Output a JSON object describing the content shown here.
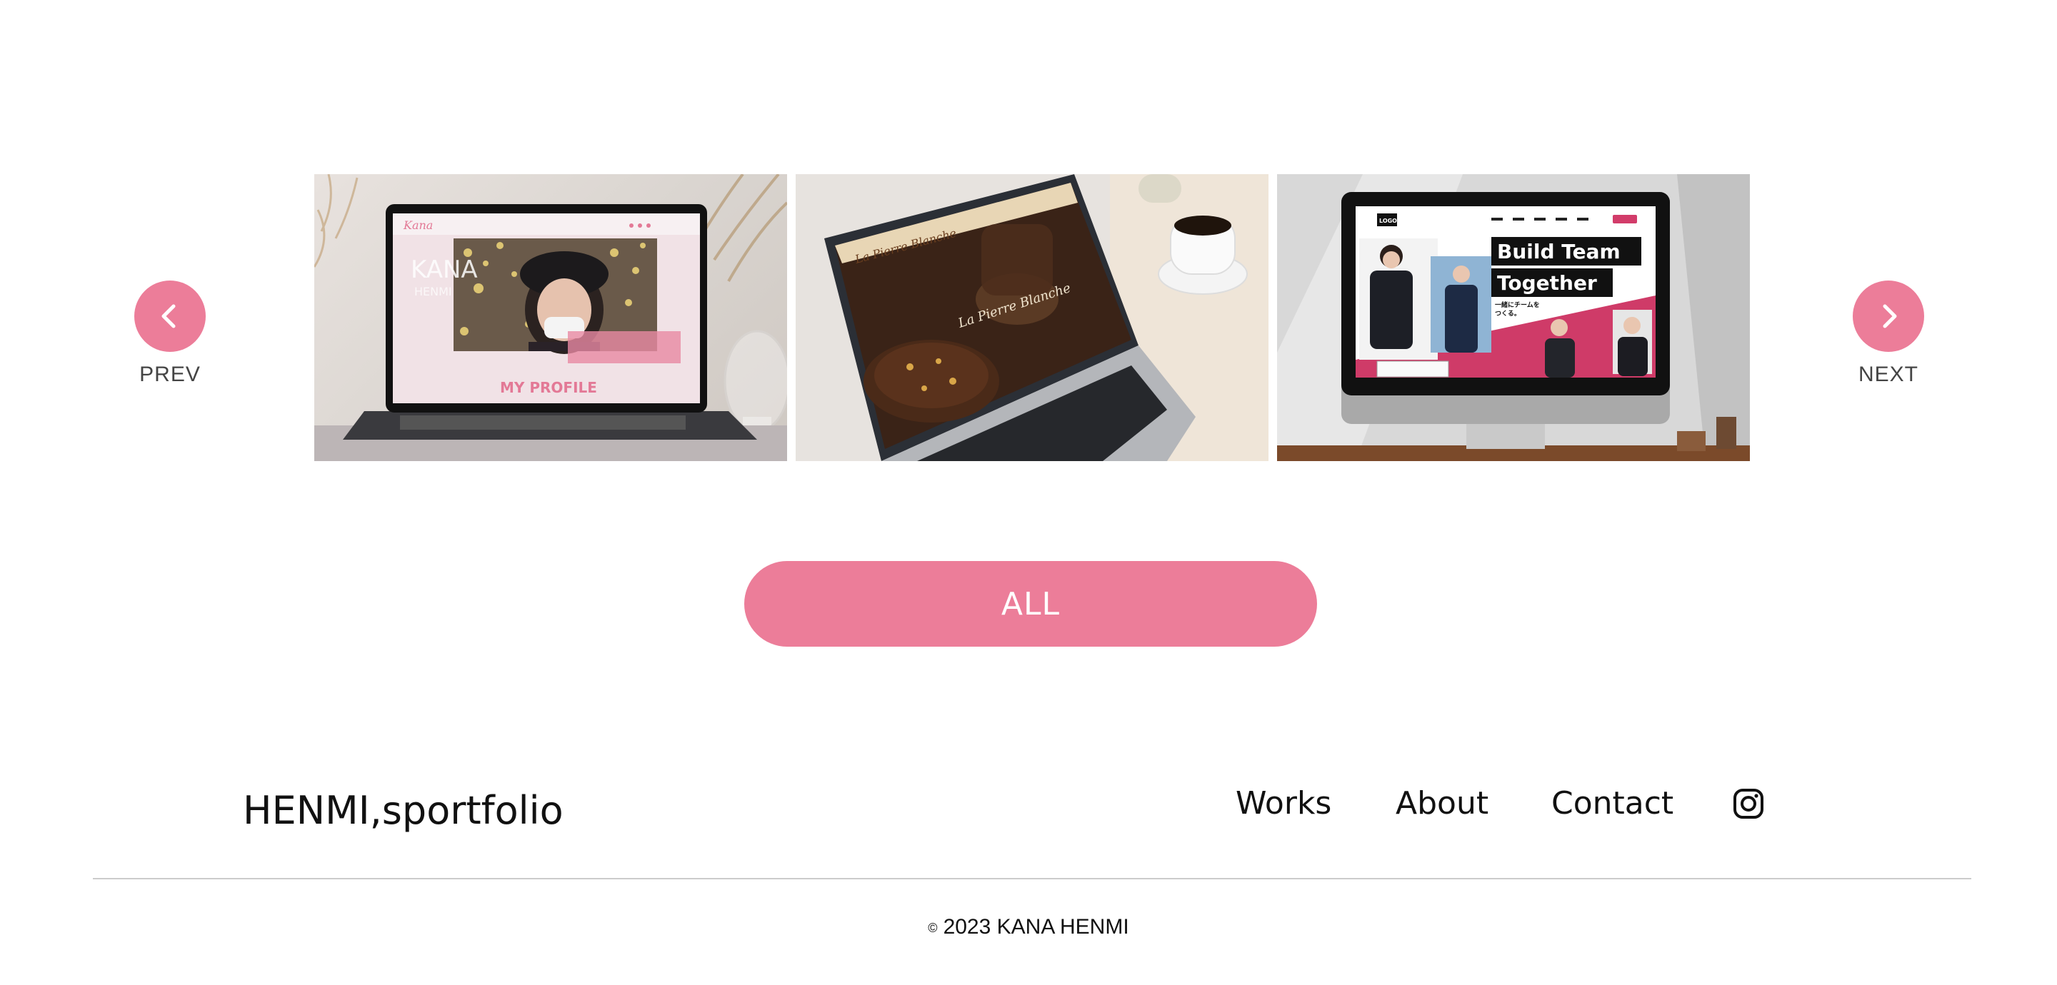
{
  "colors": {
    "accent": "#ec7d99",
    "text": "#111111",
    "divider": "#cccccc"
  },
  "carousel": {
    "prev_label": "PREV",
    "next_label": "NEXT",
    "prev_icon": "chevron-left-icon",
    "next_icon": "chevron-right-icon",
    "slides": [
      {
        "name": "laptop-profile-site",
        "screen_brand": "Kana",
        "screen_heading": "KANA",
        "screen_subheading": "HENMI",
        "screen_section": "MY PROFILE"
      },
      {
        "name": "laptop-patisserie-site",
        "screen_brand": "La Pierre Blanche",
        "screen_overlay": "La Pierre Blanche"
      },
      {
        "name": "desktop-recruit-site",
        "screen_logo": "LOGO",
        "screen_headline_1": "Build Team",
        "screen_headline_2": "Together",
        "screen_sub_1": "一緒にチームを",
        "screen_sub_2": "つくる。"
      }
    ]
  },
  "all_button": {
    "label": "ALL"
  },
  "footer": {
    "brand": "HENMI,sportfolio",
    "nav": [
      {
        "label": "Works"
      },
      {
        "label": "About"
      },
      {
        "label": "Contact"
      }
    ],
    "social_icon": "instagram-icon",
    "copyright_symbol": "©",
    "copyright": "2023 KANA HENMI"
  }
}
